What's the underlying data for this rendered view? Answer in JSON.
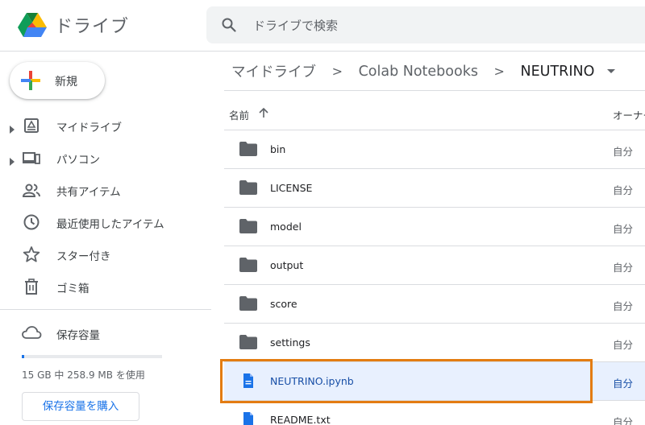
{
  "header": {
    "app_title": "ドライブ",
    "search_placeholder": "ドライブで検索"
  },
  "sidebar": {
    "new_label": "新規",
    "items": [
      {
        "label": "マイドライブ",
        "icon": "my-drive-icon",
        "expandable": true
      },
      {
        "label": "パソコン",
        "icon": "computers-icon",
        "expandable": true
      },
      {
        "label": "共有アイテム",
        "icon": "shared-icon",
        "expandable": false
      },
      {
        "label": "最近使用したアイテム",
        "icon": "clock-icon",
        "expandable": false
      },
      {
        "label": "スター付き",
        "icon": "star-icon",
        "expandable": false
      },
      {
        "label": "ゴミ箱",
        "icon": "trash-icon",
        "expandable": false
      }
    ],
    "storage": {
      "label": "保存容量",
      "usage_text": "15 GB 中 258.9 MB を使用",
      "used_fraction": 0.017,
      "buy_label": "保存容量を購入"
    }
  },
  "breadcrumb": {
    "items": [
      "マイドライブ",
      "Colab Notebooks",
      "NEUTRINO"
    ],
    "separator": ">"
  },
  "columns": {
    "name": "名前",
    "owner": "オーナー"
  },
  "files": [
    {
      "name": "bin",
      "type": "folder",
      "owner": "自分"
    },
    {
      "name": "LICENSE",
      "type": "folder",
      "owner": "自分"
    },
    {
      "name": "model",
      "type": "folder",
      "owner": "自分"
    },
    {
      "name": "output",
      "type": "folder",
      "owner": "自分"
    },
    {
      "name": "score",
      "type": "folder",
      "owner": "自分"
    },
    {
      "name": "settings",
      "type": "folder",
      "owner": "自分"
    },
    {
      "name": "NEUTRINO.ipynb",
      "type": "file",
      "owner": "自分",
      "selected": true
    },
    {
      "name": "README.txt",
      "type": "file",
      "owner": "自分"
    }
  ],
  "colors": {
    "accent": "#1a73e8",
    "highlight_border": "#e37c12",
    "selected_row": "#e8f0fe",
    "folder": "#5f6368"
  }
}
